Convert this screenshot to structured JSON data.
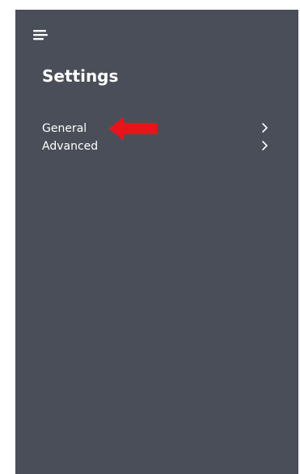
{
  "header": {
    "menu_icon": "hamburger-icon",
    "title": "Settings"
  },
  "menu": {
    "items": [
      {
        "label": "General",
        "icon": "chevron-right-icon"
      },
      {
        "label": "Advanced",
        "icon": "chevron-right-icon"
      }
    ]
  },
  "annotation": {
    "icon": "left-arrow-icon",
    "color": "#e8141a"
  },
  "colors": {
    "panel_background": "#4a4e58",
    "page_background": "#ffffff",
    "text": "#ffffff"
  }
}
